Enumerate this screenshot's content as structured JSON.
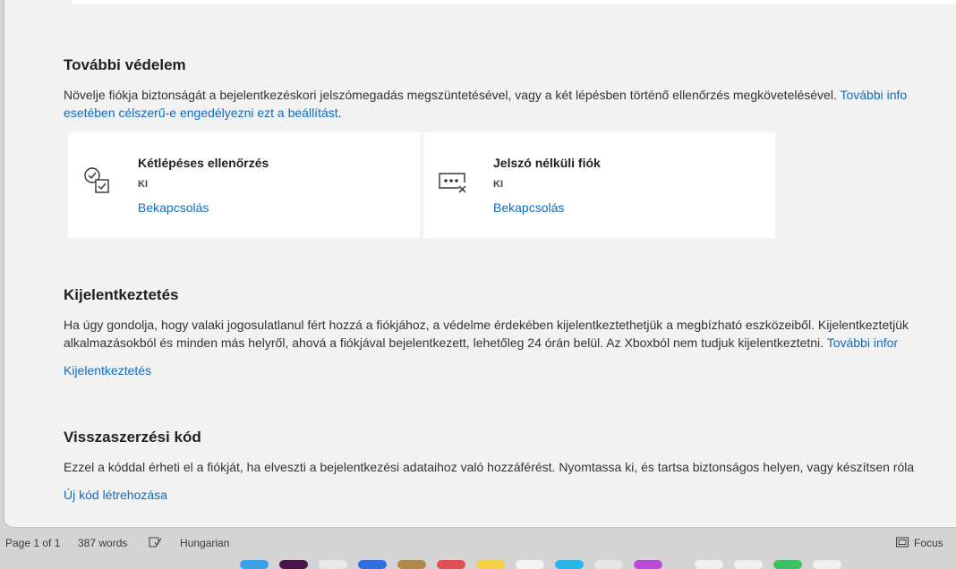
{
  "protection": {
    "title": "További védelem",
    "desc_line1": "Növelje fiókja biztonságát a bejelentkezéskori jelszómegadás megszüntetésével, vagy a két lépésben történő ellenőrzés megkövetelésével.",
    "desc_line1_link": "További info",
    "desc_line2_link": "esetében célszerű-e engedélyezni ezt a beállítást",
    "desc_line2_end": ".",
    "cards": [
      {
        "title": "Kétlépéses ellenőrzés",
        "status": "KI",
        "action": "Bekapcsolás",
        "icon": "two-step-verification-icon"
      },
      {
        "title": "Jelszó nélküli fiók",
        "status": "KI",
        "action": "Bekapcsolás",
        "icon": "passwordless-icon"
      }
    ]
  },
  "signout": {
    "title": "Kijelentkeztetés",
    "desc_line1": "Ha úgy gondolja, hogy valaki jogosulatlanul fért hozzá a fiókjához, a védelme érdekében kijelentkeztethetjük a megbízható eszközeiből. Kijelentkeztetjük",
    "desc_line2": "alkalmazásokból és minden más helyről, ahová a fiókjával bejelentkezett, lehetőleg 24 órán belül. Az Xboxból nem tudjuk kijelentkeztetni.",
    "desc_line2_link": "További infor",
    "action": "Kijelentkeztetés"
  },
  "recovery": {
    "title": "Visszaszerzési kód",
    "desc_line1": "Ezzel a kóddal érheti el a fiókját, ha elveszti a bejelentkezési adataihoz való hozzáférést. Nyomtassa ki, és tartsa biztonságos helyen, vagy készítsen róla",
    "action": "Új kód létrehozása"
  },
  "statusbar": {
    "page": "Page 1 of 1",
    "words": "387 words",
    "language": "Hungarian",
    "focus": "Focus"
  },
  "colors": {
    "link": "#0f6cbd",
    "page_bg": "#f2f2f2",
    "card_bg": "#ffffff"
  }
}
